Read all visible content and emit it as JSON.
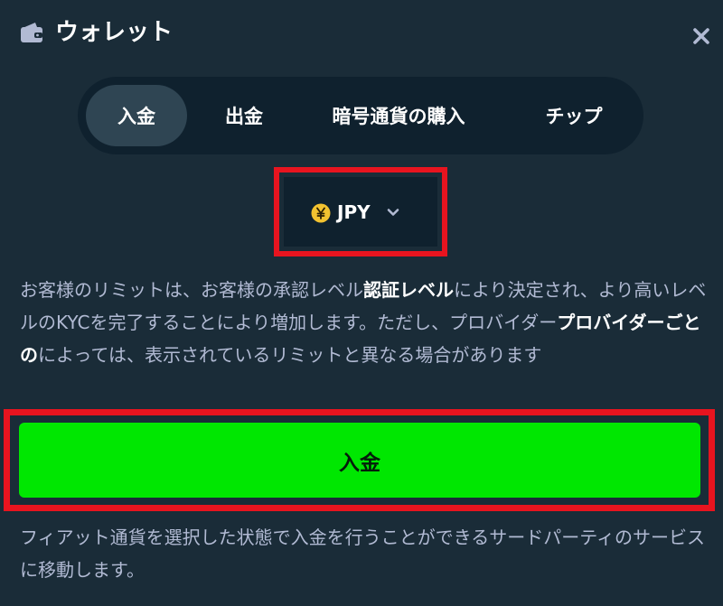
{
  "header": {
    "icon": "wallet-icon",
    "title": "ウォレット",
    "close_icon": "close-icon"
  },
  "tabs": [
    {
      "label": "入金",
      "active": true
    },
    {
      "label": "出金",
      "active": false
    },
    {
      "label": "暗号通貨の購入",
      "active": false
    },
    {
      "label": "チップ",
      "active": false
    }
  ],
  "currency": {
    "icon": "yen-coin-icon",
    "code": "JPY",
    "dropdown_icon": "chevron-down-icon"
  },
  "info": {
    "part1": "お客様のリミットは、お客様の承認レベル",
    "bold1": "認証レベル",
    "part2": "により決定され、より高いレベルのKYCを完了することにより増加します。ただし、プロバイダー",
    "bold2": "プロバイダーごとの",
    "part3": "によっては、表示されているリミットと異なる場合があります"
  },
  "deposit_button": {
    "label": "入金"
  },
  "note": {
    "text": "フィアット通貨を選択した状態で入金を行うことができるサードパーティのサービスに移動します。"
  },
  "colors": {
    "background": "#1a2c38",
    "panel": "#0f212e",
    "active_tab": "#2f4553",
    "accent_green": "#00e701",
    "highlight_red": "#e8141f",
    "coin_gold": "#f2c230"
  }
}
